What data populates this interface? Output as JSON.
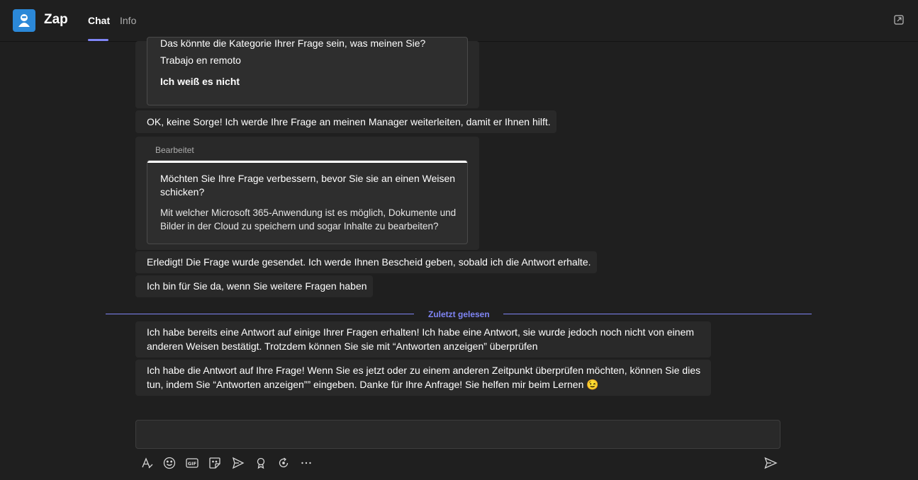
{
  "header": {
    "app_name": "Zap",
    "tabs": [
      {
        "label": "Chat",
        "active": true
      },
      {
        "label": "Info",
        "active": false
      }
    ]
  },
  "messages": {
    "category_card": {
      "prompt": "Das könnte die Kategorie Ihrer Frage sein, was meinen Sie?",
      "option_1": "Trabajo en remoto",
      "option_2": "Ich weiß es nicht"
    },
    "forward_msg": "OK, keine Sorge! Ich werde Ihre Frage an meinen Manager weiterleiten, damit er Ihnen hilft.",
    "edit_card": {
      "edited_label": "Bearbeitet",
      "title_line1": "Möchten Sie Ihre Frage verbessern, bevor Sie sie an einen Weisen",
      "title_line2": "schicken?",
      "question_line1": "Mit welcher Microsoft 365-Anwendung ist es möglich, Dokumente und",
      "question_line2": "Bilder in der Cloud zu speichern und sogar Inhalte zu bearbeiten?"
    },
    "done_msg": "Erledigt! Die Frage wurde gesendet. Ich werde Ihnen Bescheid geben, sobald ich die Antwort erhalte.",
    "here_msg": "Ich bin für Sie da, wenn Sie weitere Fragen haben",
    "divider_label": "Zuletzt gelesen",
    "answer_msg_line1": "Ich habe bereits eine Antwort auf einige Ihrer Fragen erhalten! Ich habe eine Antwort, sie wurde jedoch noch nicht von einem",
    "answer_msg_line2": "anderen Weisen bestätigt. Trotzdem können Sie sie mit “Antworten anzeigen” überprüfen",
    "final_msg_line1": "Ich habe die Antwort auf Ihre Frage! Wenn Sie es jetzt oder zu einem anderen Zeitpunkt überprüfen möchten, können Sie dies",
    "final_msg_line2": "tun, indem Sie “Antworten anzeigen”” eingeben. Danke für Ihre Anfrage! Sie helfen mir beim Lernen 😉"
  },
  "compose": {
    "value": "",
    "placeholder": ""
  },
  "toolbar_icons": [
    "format-icon",
    "emoji-icon",
    "gif-icon",
    "sticker-icon",
    "schedule-icon",
    "praise-icon",
    "loop-icon",
    "more-icon",
    "send-icon"
  ],
  "colors": {
    "accent": "#7f85f5",
    "background": "#1f1f1f",
    "bubble": "#292929",
    "app_icon": "#2b88d8"
  }
}
